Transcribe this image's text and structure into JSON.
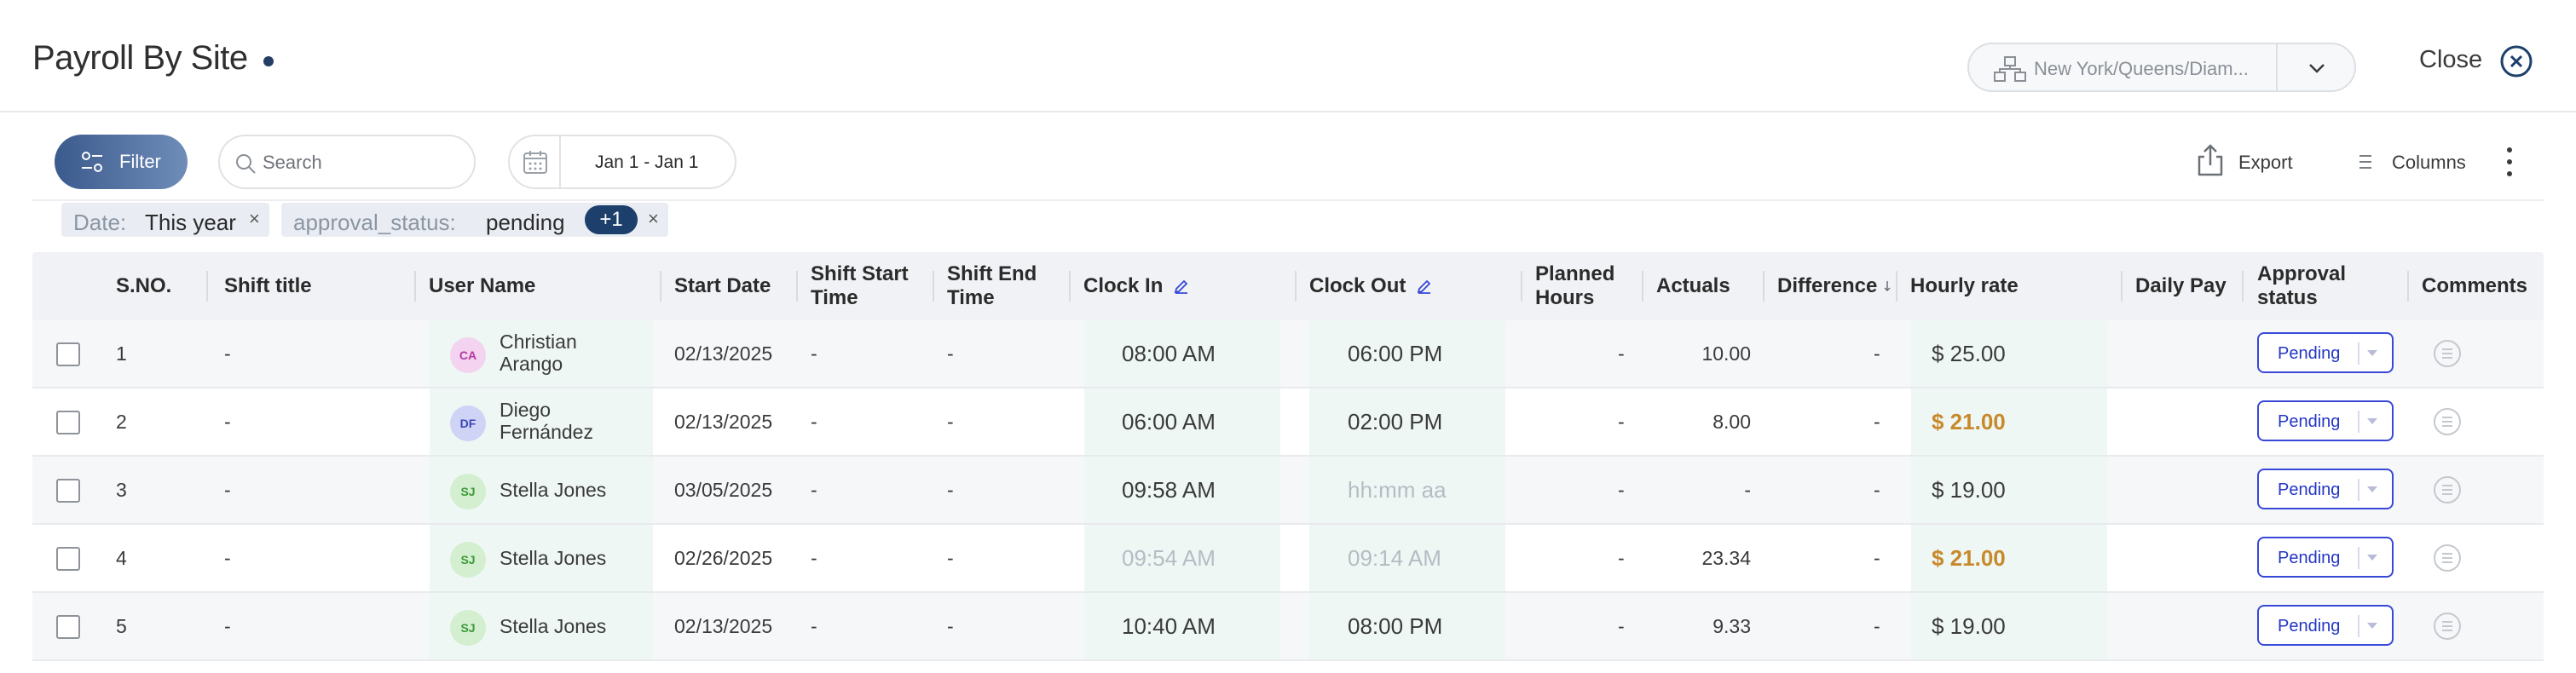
{
  "header": {
    "title": "Payroll By Site",
    "site_selector": {
      "value": "New York/Queens/Diam..."
    },
    "close_label": "Close"
  },
  "toolbar": {
    "filter_label": "Filter",
    "search_placeholder": "Search",
    "date_range": "Jan 1 - Jan 1",
    "export_label": "Export",
    "columns_label": "Columns"
  },
  "chips": [
    {
      "key": "Date:",
      "value": "This year",
      "remove": "×"
    },
    {
      "key": "approval_status:",
      "value": "pending",
      "badge": "+1",
      "remove": "×"
    }
  ],
  "table": {
    "columns": [
      "S.NO.",
      "Shift title",
      "User Name",
      "Start Date",
      "Shift Start Time",
      "Shift End Time",
      "Clock In",
      "Clock Out",
      "Planned Hours",
      "Actuals",
      "Difference",
      "Hourly rate",
      "Daily Pay",
      "Approval status",
      "Comments"
    ],
    "rows": [
      {
        "sno": "1",
        "shift_title": "-",
        "initials": "CA",
        "user_name": "Christian Arango",
        "start_date": "02/13/2025",
        "shift_start": "-",
        "shift_end": "-",
        "clock_in": "08:00 AM",
        "clock_in_placeholder": false,
        "clock_out": "06:00 PM",
        "clock_out_placeholder": false,
        "planned": "-",
        "actuals": "10.00",
        "difference": "-",
        "hourly_rate": "$ 25.00",
        "rate_highlight": false,
        "daily_pay": "",
        "status": "Pending",
        "avatar_bg": "#f3d3ef",
        "avatar_fg": "#b23aa2"
      },
      {
        "sno": "2",
        "shift_title": "-",
        "initials": "DF",
        "user_name": "Diego Fernández",
        "start_date": "02/13/2025",
        "shift_start": "-",
        "shift_end": "-",
        "clock_in": "06:00 AM",
        "clock_in_placeholder": false,
        "clock_out": "02:00 PM",
        "clock_out_placeholder": false,
        "planned": "-",
        "actuals": "8.00",
        "difference": "-",
        "hourly_rate": "$ 21.00",
        "rate_highlight": true,
        "daily_pay": "",
        "status": "Pending",
        "avatar_bg": "#cfd3f5",
        "avatar_fg": "#3a45b8"
      },
      {
        "sno": "3",
        "shift_title": "-",
        "initials": "SJ",
        "user_name": "Stella Jones",
        "start_date": "03/05/2025",
        "shift_start": "-",
        "shift_end": "-",
        "clock_in": "09:58 AM",
        "clock_in_placeholder": false,
        "clock_out": "hh:mm aa",
        "clock_out_placeholder": true,
        "planned": "-",
        "actuals": "-",
        "difference": "-",
        "hourly_rate": "$ 19.00",
        "rate_highlight": false,
        "daily_pay": "",
        "status": "Pending",
        "avatar_bg": "#d3efcf",
        "avatar_fg": "#3d9a3a"
      },
      {
        "sno": "4",
        "shift_title": "-",
        "initials": "SJ",
        "user_name": "Stella Jones",
        "start_date": "02/26/2025",
        "shift_start": "-",
        "shift_end": "-",
        "clock_in": "09:54 AM",
        "clock_in_placeholder": true,
        "clock_out": "09:14 AM",
        "clock_out_placeholder": true,
        "planned": "-",
        "actuals": "23.34",
        "difference": "-",
        "hourly_rate": "$ 21.00",
        "rate_highlight": true,
        "daily_pay": "",
        "status": "Pending",
        "avatar_bg": "#d3efcf",
        "avatar_fg": "#3d9a3a"
      },
      {
        "sno": "5",
        "shift_title": "-",
        "initials": "SJ",
        "user_name": "Stella Jones",
        "start_date": "02/13/2025",
        "shift_start": "-",
        "shift_end": "-",
        "clock_in": "10:40 AM",
        "clock_in_placeholder": false,
        "clock_out": "08:00 PM",
        "clock_out_placeholder": false,
        "planned": "-",
        "actuals": "9.33",
        "difference": "-",
        "hourly_rate": "$ 19.00",
        "rate_highlight": false,
        "daily_pay": "",
        "status": "Pending",
        "avatar_bg": "#d3efcf",
        "avatar_fg": "#3d9a3a"
      }
    ]
  },
  "colors": {
    "accent": "#2436c4",
    "rate_highlight": "#c8892b",
    "filter_button": "#3b5a8d",
    "clock_shade": "#eef7f4",
    "title_dot": "#263e66"
  },
  "icons": [
    "site-hierarchy-icon",
    "chevron-down-icon",
    "close-icon",
    "filter-sliders-icon",
    "search-icon",
    "calendar-icon",
    "export-icon",
    "columns-icon",
    "more-vertical-icon",
    "edit-pencil-icon",
    "sort-arrow-icon",
    "comment-icon"
  ]
}
